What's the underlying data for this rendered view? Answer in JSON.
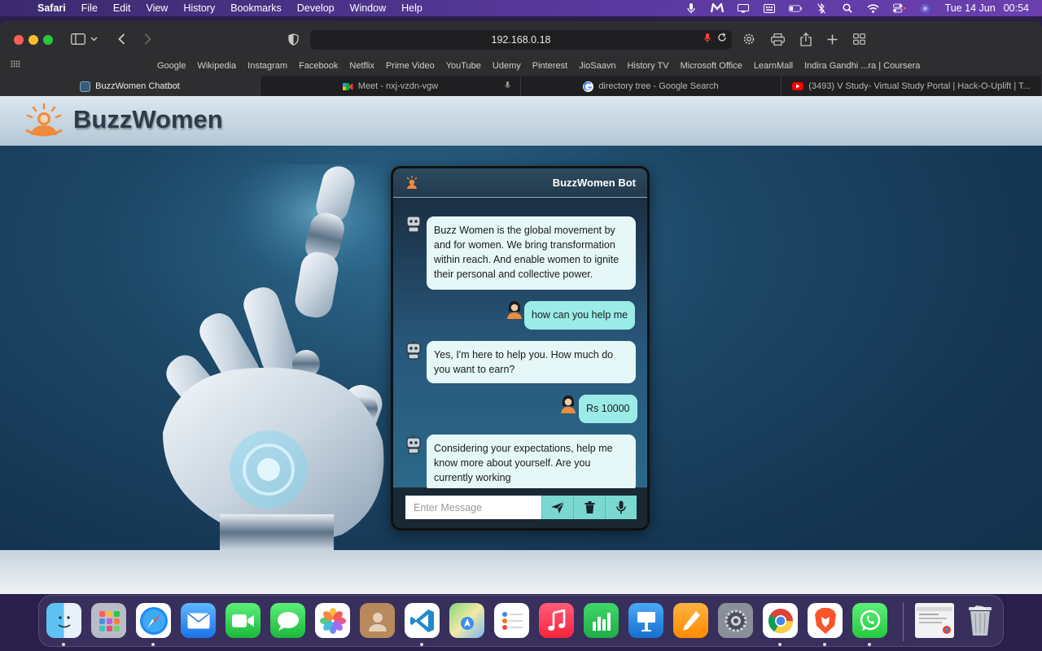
{
  "menubar": {
    "app_name": "Safari",
    "items": [
      "File",
      "Edit",
      "View",
      "History",
      "Bookmarks",
      "Develop",
      "Window",
      "Help"
    ],
    "date": "Tue 14 Jun",
    "time": "00:54"
  },
  "browser": {
    "url": "192.168.0.18",
    "bookmarks": [
      "Google",
      "Wikipedia",
      "Instagram",
      "Facebook",
      "Netflix",
      "Prime Video",
      "YouTube",
      "Udemy",
      "Pinterest",
      "JioSaavn",
      "History TV",
      "Microsoft Office",
      "LearnMall",
      "Indira Gandhi ...ra | Coursera"
    ],
    "tabs": [
      {
        "title": "BuzzWomen Chatbot",
        "active": true
      },
      {
        "title": "Meet - nxj-vzdn-vgw",
        "active": false
      },
      {
        "title": "directory tree - Google Search",
        "active": false
      },
      {
        "title": "(3493) V Study- Virtual Study Portal | Hack-O-Uplift | T...",
        "active": false
      }
    ]
  },
  "page": {
    "brand": "BuzzWomen",
    "chat": {
      "title": "BuzzWomen Bot",
      "messages": [
        {
          "from": "bot",
          "text": "Buzz Women is the global movement by and for women. We bring transformation within reach. And enable women to ignite their personal and collective power."
        },
        {
          "from": "user",
          "text": "how can you help me"
        },
        {
          "from": "bot",
          "text": "Yes, I'm here to help you. How much do you want to earn?"
        },
        {
          "from": "user",
          "text": "Rs 10000"
        },
        {
          "from": "bot",
          "text": "Considering your expectations, help me know more about yourself. Are you currently working"
        }
      ],
      "input_placeholder": "Enter Message"
    }
  },
  "colors": {
    "accent": "#7ad8d0",
    "user_bubble": "#9bece8",
    "bot_bubble": "#e6f7f7",
    "brand_orange": "#f08a3c"
  },
  "dock": {
    "apps": [
      "finder-icon",
      "launchpad-icon",
      "safari-icon",
      "mail-icon",
      "facetime-icon",
      "messages-icon",
      "photos-icon",
      "contacts-icon",
      "vscode-icon",
      "maps-icon",
      "reminders-icon",
      "music-icon",
      "numbers-icon",
      "keynote-icon",
      "pages-icon",
      "system-preferences-icon",
      "chrome-icon",
      "brave-icon",
      "whatsapp-icon",
      "chrome-window-preview-icon",
      "trash-icon"
    ]
  }
}
